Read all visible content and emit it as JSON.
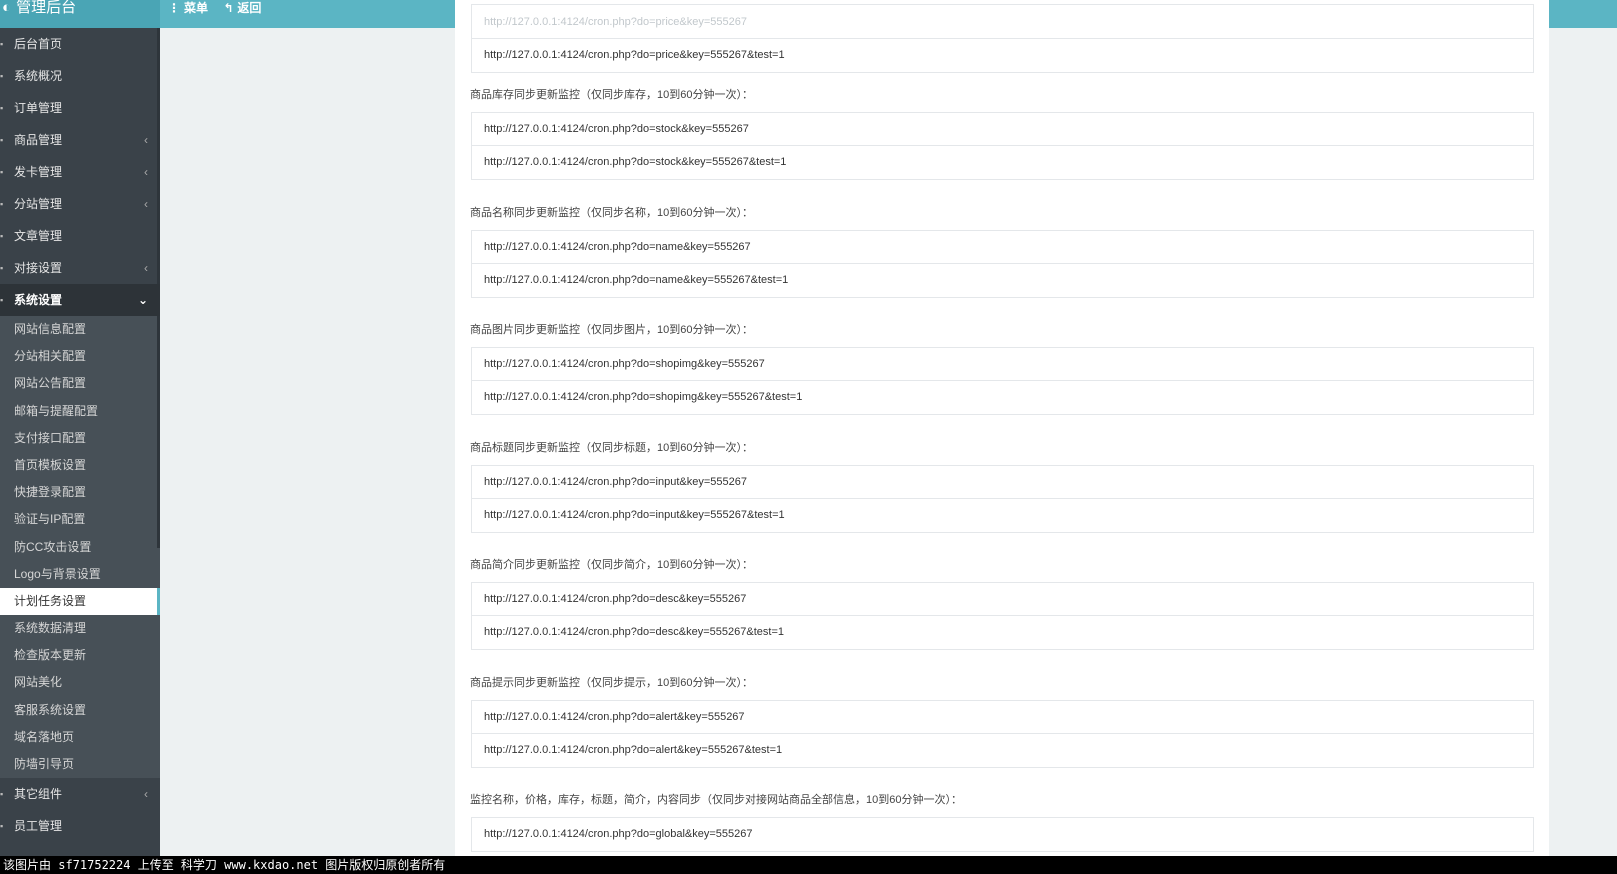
{
  "header": {
    "brand_title": "管理后台",
    "menu_label": "菜单",
    "back_label": "返回"
  },
  "sidebar": {
    "items": [
      {
        "label": "后台首页",
        "has_arrow": false
      },
      {
        "label": "系统概况",
        "has_arrow": false
      },
      {
        "label": "订单管理",
        "has_arrow": false
      },
      {
        "label": "商品管理",
        "has_arrow": true
      },
      {
        "label": "发卡管理",
        "has_arrow": true
      },
      {
        "label": "分站管理",
        "has_arrow": true
      },
      {
        "label": "文章管理",
        "has_arrow": false
      },
      {
        "label": "对接设置",
        "has_arrow": true
      },
      {
        "label": "系统设置",
        "has_arrow": true,
        "expanded": true
      }
    ],
    "submenu": [
      "网站信息配置",
      "分站相关配置",
      "网站公告配置",
      "邮箱与提醒配置",
      "支付接口配置",
      "首页模板设置",
      "快捷登录配置",
      "验证与IP配置",
      "防CC攻击设置",
      "Logo与背景设置",
      "计划任务设置",
      "系统数据清理",
      "检查版本更新",
      "网站美化",
      "客服系统设置",
      "域名落地页",
      "防墙引导页"
    ],
    "current_sub": "计划任务设置",
    "bottom_items": [
      {
        "label": "其它组件",
        "has_arrow": true
      },
      {
        "label": "员工管理",
        "has_arrow": false
      }
    ]
  },
  "content": {
    "top_group": {
      "urls": [
        "http://127.0.0.1:4124/cron.php?do=price&key=555267",
        "http://127.0.0.1:4124/cron.php?do=price&key=555267&test=1"
      ]
    },
    "sections": [
      {
        "label": "商品库存同步更新监控（仅同步库存，10到60分钟一次）：",
        "urls": [
          "http://127.0.0.1:4124/cron.php?do=stock&key=555267",
          "http://127.0.0.1:4124/cron.php?do=stock&key=555267&test=1"
        ]
      },
      {
        "label": "商品名称同步更新监控（仅同步名称，10到60分钟一次）：",
        "urls": [
          "http://127.0.0.1:4124/cron.php?do=name&key=555267",
          "http://127.0.0.1:4124/cron.php?do=name&key=555267&test=1"
        ]
      },
      {
        "label": "商品图片同步更新监控（仅同步图片，10到60分钟一次）：",
        "urls": [
          "http://127.0.0.1:4124/cron.php?do=shopimg&key=555267",
          "http://127.0.0.1:4124/cron.php?do=shopimg&key=555267&test=1"
        ]
      },
      {
        "label": "商品标题同步更新监控（仅同步标题，10到60分钟一次）：",
        "urls": [
          "http://127.0.0.1:4124/cron.php?do=input&key=555267",
          "http://127.0.0.1:4124/cron.php?do=input&key=555267&test=1"
        ]
      },
      {
        "label": "商品简介同步更新监控（仅同步简介，10到60分钟一次）：",
        "urls": [
          "http://127.0.0.1:4124/cron.php?do=desc&key=555267",
          "http://127.0.0.1:4124/cron.php?do=desc&key=555267&test=1"
        ]
      },
      {
        "label": "商品提示同步更新监控（仅同步提示，10到60分钟一次）：",
        "urls": [
          "http://127.0.0.1:4124/cron.php?do=alert&key=555267",
          "http://127.0.0.1:4124/cron.php?do=alert&key=555267&test=1"
        ]
      },
      {
        "label": "监控名称，价格，库存，标题，简介，内容同步（仅同步对接网站商品全部信息，10到60分钟一次）：",
        "urls": [
          "http://127.0.0.1:4124/cron.php?do=global&key=555267"
        ]
      }
    ]
  },
  "footer": {
    "watermark": "该图片由 sf71752224 上传至 科学刀 www.kxdao.net 图片版权归原创者所有"
  },
  "colors": {
    "topbar": "#5bb5c4",
    "sidebar": "#3a4249",
    "submenu": "#475057",
    "page_bg": "#edf1f2"
  }
}
